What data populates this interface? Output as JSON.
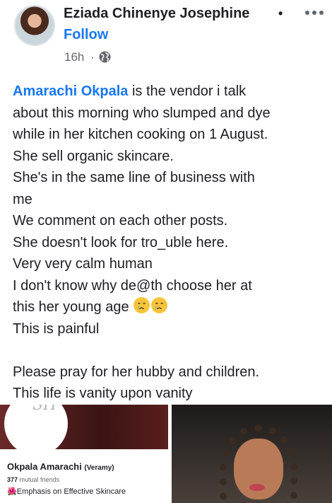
{
  "header": {
    "author_name": "Eziada Chinenye Josephine",
    "separator": "•",
    "follow_label": "Follow",
    "time": "16h",
    "dot": "·",
    "privacy_icon": "globe-icon",
    "more_icon": "more-options-icon"
  },
  "post": {
    "mention": "Amarachi Okpala",
    "line1_rest": " is the vendor i talk",
    "line2": "about this morning who slumped and dye",
    "line3": "while in her kitchen cooking on 1 August.",
    "line4": "She sell organic skincare.",
    "line5": "She's in the same line of business with",
    "line6": "me",
    "line7": "We comment on each other posts.",
    "line8": "She doesn't look for tro_uble here.",
    "line9": "Very very calm human",
    "line10": "I don't know why de@th choose her at",
    "line11": "this her young age",
    "line12": "This is painful",
    "line13": "Please pray for her hubby and children.",
    "line14": "This life is vanity upon vanity"
  },
  "photos": {
    "left": {
      "logo_text": "SH",
      "profile_name": "Okpala Amarachi",
      "profile_alias": "(Veramy)",
      "mutual_count": "377",
      "mutual_label": "mutual friends",
      "bio": "🌺Emphasis on Effective Skincare"
    }
  }
}
